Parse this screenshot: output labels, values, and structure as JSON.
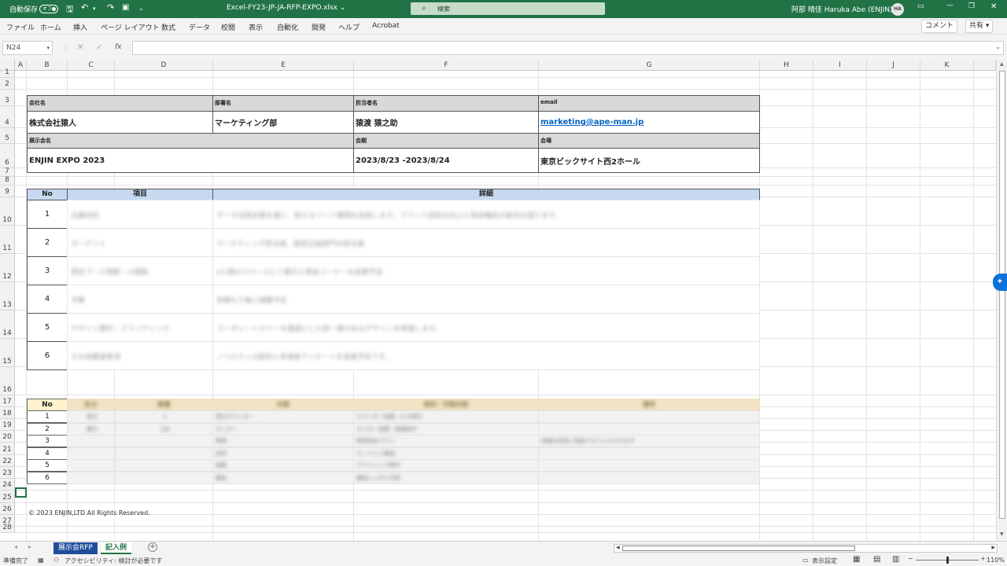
{
  "titlebar": {
    "autosave_label": "自動保存",
    "autosave_state": "オフ",
    "filename": "Excel-FY23-JP-JA-RFP-EXPO.xlsx ⌄",
    "search_placeholder": "検索",
    "user": "阿部 晴佳 Haruka Abe (ENJIN)",
    "avatar": "HA"
  },
  "menu": [
    "ファイル",
    "ホーム",
    "挿入",
    "ページ レイアウト",
    "数式",
    "データ",
    "校閲",
    "表示",
    "自動化",
    "開発",
    "ヘルプ",
    "Acrobat"
  ],
  "ribbon_buttons": {
    "comment": "コメント",
    "share": "共有"
  },
  "formula_bar": {
    "namebox": "N24",
    "fx": "fx",
    "content": ""
  },
  "columns": [
    "A",
    "B",
    "C",
    "D",
    "E",
    "F",
    "G",
    "H",
    "I",
    "J",
    "K"
  ],
  "rows": [
    "1",
    "2",
    "3",
    "4",
    "5",
    "6",
    "7",
    "8",
    "9",
    "10",
    "11",
    "12",
    "13",
    "14",
    "15",
    "16",
    "17",
    "18",
    "19",
    "20",
    "21",
    "22",
    "23",
    "24",
    "25",
    "26",
    "27",
    "28"
  ],
  "info": {
    "company_label": "会社名",
    "company": "株式会社猿人",
    "dept_label": "部署名",
    "dept": "マーケティング部",
    "person_label": "担当者名",
    "person": "猿渡 猿之助",
    "email_label": "email",
    "email": "marketing@ape-man.jp",
    "expo_label": "展示会名",
    "expo": "ENJIN EXPO 2023",
    "period_label": "会期",
    "period": "2023/8/23 -2023/8/24",
    "venue_label": "会場",
    "venue": "東京ビックサイト西2ホール"
  },
  "table1": {
    "headers": [
      "No",
      "項目",
      "詳細"
    ],
    "rows": [
      {
        "no": "1",
        "item": "出展目的",
        "detail": "データ活用支援を通じ、新たなリード獲得を目指します。ブランド認知の向上と商談機会の創出を図ります。"
      },
      {
        "no": "2",
        "item": "ターゲット",
        "detail": "マーケティング担当者、経営企画部門の担当者"
      },
      {
        "no": "3",
        "item": "想定ブース規模・小間数",
        "detail": "2小間のスペースにて展示と商談コーナーを設置予定"
      },
      {
        "no": "4",
        "item": "予算",
        "detail": "見積もり後に調整予定"
      },
      {
        "no": "5",
        "item": "デザイン要件・ブランディング",
        "detail": "コーポレートカラーを基調とした統一感のあるデザインを希望します。"
      },
      {
        "no": "6",
        "item": "その他要望事項",
        "detail": "ノベルティの配布と来場者アンケートを実施予定です。"
      }
    ]
  },
  "table2": {
    "headers": [
      "No",
      "区分",
      "数量",
      "内容",
      "制作・手配内容",
      "備考"
    ],
    "rows": [
      {
        "no": "1",
        "c": "受付",
        "d": "1",
        "e": "受付カウンター",
        "f": "カウンター設置・ロゴ掲示",
        "g": ""
      },
      {
        "no": "2",
        "c": "展示",
        "d": "2台",
        "e": "モニター",
        "f": "モニター設置・映像制作",
        "g": ""
      },
      {
        "no": "3",
        "c": "",
        "d": "",
        "e": "照明",
        "f": "照明演出プラン",
        "g": "詳細は別途ご相談させていただきます"
      },
      {
        "no": "4",
        "c": "",
        "d": "",
        "e": "床材",
        "f": "カーペット敷設",
        "g": ""
      },
      {
        "no": "5",
        "c": "",
        "d": "",
        "e": "装飾",
        "f": "グラフィック制作",
        "g": ""
      },
      {
        "no": "6",
        "c": "",
        "d": "",
        "e": "備品",
        "f": "備品レンタル手配",
        "g": ""
      }
    ]
  },
  "copyright": "© 2023 ENJIN,LTD  All Rights Reserved.",
  "sheet_tabs": [
    "展示会RFP",
    "記入例"
  ],
  "status": {
    "ready": "準備完了",
    "accessibility": "アクセシビリティ: 検討が必要です",
    "display_settings": "表示設定",
    "zoom": "110%"
  },
  "colors": {
    "excel_green": "#217346",
    "table_header_blue": "#c6d9f1",
    "label_gray": "#d9d9d9",
    "table2_header": "#f2e3c4"
  }
}
